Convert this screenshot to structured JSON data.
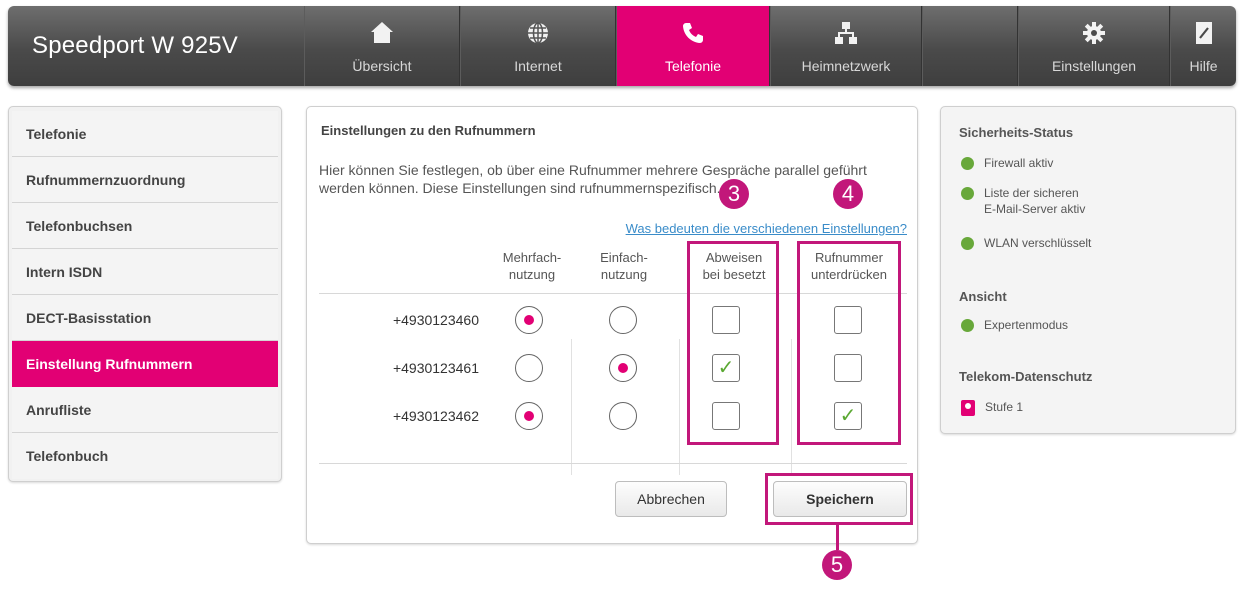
{
  "app": {
    "brand": "Speedport W 925V",
    "nav": [
      {
        "key": "uebersicht",
        "label": "Übersicht",
        "icon": "home-icon"
      },
      {
        "key": "internet",
        "label": "Internet",
        "icon": "globe-icon"
      },
      {
        "key": "telefonie",
        "label": "Telefonie",
        "icon": "phone-icon",
        "active": true
      },
      {
        "key": "heimnetzwerk",
        "label": "Heimnetzwerk",
        "icon": "network-icon"
      },
      {
        "key": "einstellungen",
        "label": "Einstellungen",
        "icon": "gear-icon"
      },
      {
        "key": "hilfe",
        "label": "Hilfe",
        "icon": "help-book-icon"
      }
    ],
    "accent_color": "#e20074"
  },
  "sidebar": {
    "items": [
      {
        "label": "Telefonie"
      },
      {
        "label": "Rufnummernzuordnung"
      },
      {
        "label": "Telefonbuchsen"
      },
      {
        "label": "Intern ISDN"
      },
      {
        "label": "DECT-Basisstation"
      },
      {
        "label": "Einstellung Rufnummern",
        "active": true
      },
      {
        "label": "Anrufliste"
      },
      {
        "label": "Telefonbuch"
      }
    ]
  },
  "main": {
    "title": "Einstellungen zu den Rufnummern",
    "description": "Hier können Sie festlegen, ob über eine Rufnummer mehrere Gespräche parallel geführt werden können. Diese Einstellungen sind rufnummernspezifisch.",
    "help_link": "Was bedeuten die verschiedenen Einstellungen?",
    "columns": {
      "mehrfach": [
        "Mehrfach-",
        "nutzung"
      ],
      "einfach": [
        "Einfach-",
        "nutzung"
      ],
      "abweisen": [
        "Abweisen",
        "bei besetzt"
      ],
      "unterdruecken": [
        "Rufnummer",
        "unterdrücken"
      ]
    },
    "rows": [
      {
        "number": "+4930123460",
        "mode": "mehrfach",
        "abweisen": false,
        "unterdruecken": false
      },
      {
        "number": "+4930123461",
        "mode": "einfach",
        "abweisen": true,
        "unterdruecken": false
      },
      {
        "number": "+4930123462",
        "mode": "mehrfach",
        "abweisen": false,
        "unterdruecken": true
      }
    ],
    "cancel_label": "Abbrechen",
    "save_label": "Speichern",
    "callouts": {
      "abweisen": "3",
      "unterdruecken": "4",
      "save": "5"
    }
  },
  "status": {
    "security_title": "Sicherheits-Status",
    "firewall": "Firewall aktiv",
    "mail_line1": "Liste der sicheren",
    "mail_line2": "E-Mail-Server aktiv",
    "wlan": "WLAN verschlüsselt",
    "view_title": "Ansicht",
    "expert": "Expertenmodus",
    "privacy_title": "Telekom-Datenschutz",
    "privacy_level": "Stufe 1"
  }
}
